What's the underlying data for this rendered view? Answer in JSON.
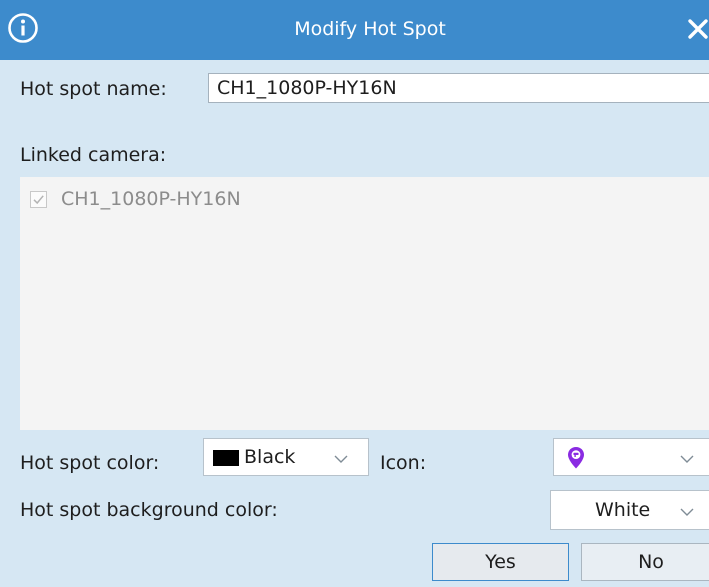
{
  "window": {
    "title": "Modify Hot Spot",
    "info_icon": "info-icon",
    "close_icon": "close-icon"
  },
  "form": {
    "name_label": "Hot spot name:",
    "name_value": "CH1_1080P-HY16N",
    "linked_label": "Linked camera:",
    "cameras": [
      {
        "label": "CH1_1080P-HY16N",
        "checked": true,
        "disabled": true
      }
    ],
    "color_label": "Hot spot color:",
    "color_value": "Black",
    "color_swatch": "#000000",
    "icon_label": "Icon:",
    "icon_value": "map-pin-icon",
    "icon_color": "#8a2be2",
    "bg_label": "Hot spot background color:",
    "bg_value": "White",
    "bg_swatch": "#ffffff"
  },
  "buttons": {
    "yes": "Yes",
    "no": "No"
  },
  "colors": {
    "title_bar": "#3d8bcc",
    "dialog_bg": "#d6e7f3",
    "list_bg": "#f4f4f4",
    "accent_border": "#3d8bcc"
  }
}
